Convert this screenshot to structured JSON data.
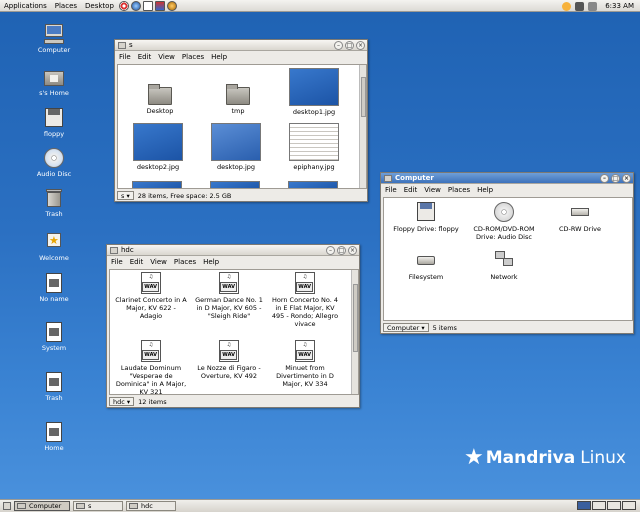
{
  "top_panel": {
    "menus": [
      "Applications",
      "Places",
      "Desktop"
    ],
    "launchers": [
      "lifebuoy-icon",
      "web-browser-icon",
      "mail-icon",
      "office-icon",
      "terminal-icon"
    ],
    "tray_icons": [
      "speaker-icon",
      "power-icon",
      "network-icon"
    ],
    "clock": "6:33 AM"
  },
  "desktop_icons": [
    {
      "label": "Computer",
      "icon": "computer-icon"
    },
    {
      "label": "s's Home",
      "icon": "home-folder-icon"
    },
    {
      "label": "floppy",
      "icon": "floppy-icon"
    },
    {
      "label": "Audio Disc",
      "icon": "cd-icon"
    },
    {
      "label": "Trash",
      "icon": "trash-icon"
    },
    {
      "label": "Welcome",
      "icon": "welcome-icon"
    },
    {
      "label": "No name",
      "icon": "document-icon"
    },
    {
      "label": "System",
      "icon": "system-folder-icon"
    },
    {
      "label": "Trash",
      "icon": "trash-folder-icon"
    },
    {
      "label": "Home",
      "icon": "home-icon"
    }
  ],
  "menu_labels": [
    "File",
    "Edit",
    "View",
    "Places",
    "Help"
  ],
  "win_s": {
    "title": "s",
    "items": [
      {
        "label": "Desktop",
        "kind": "folder"
      },
      {
        "label": "tmp",
        "kind": "folder"
      },
      {
        "label": "desktop1.jpg",
        "kind": "image"
      },
      {
        "label": "desktop2.jpg",
        "kind": "image"
      },
      {
        "label": "desktop.jpg",
        "kind": "image"
      },
      {
        "label": "epiphany.jpg",
        "kind": "image"
      }
    ],
    "location": "s",
    "status": "28 items, Free space: 2.5 GB"
  },
  "win_hdc": {
    "title": "hdc",
    "items": [
      {
        "label": "Clarinet Concerto in A Major, KV 622 - Adagio"
      },
      {
        "label": "German Dance No. 1 in D Major, KV 605 - \"Sleigh Ride\""
      },
      {
        "label": "Horn Concerto No. 4 in E Flat Major, KV 495 - Rondo; Allegro vivace"
      },
      {
        "label": "Laudate Dominum \"Vesperae de Dominica\" in A Major, KV 321"
      },
      {
        "label": "Le Nozze di Figaro - Overture, KV 492"
      },
      {
        "label": "Minuet from Divertimento in D Major, KV 334"
      }
    ],
    "location": "hdc",
    "status": "12 items"
  },
  "win_computer": {
    "title": "Computer",
    "items": [
      {
        "label": "Floppy Drive: floppy",
        "icon": "floppy-drive-icon"
      },
      {
        "label": "CD-ROM/DVD-ROM Drive: Audio Disc",
        "icon": "cd-drive-icon"
      },
      {
        "label": "CD-RW Drive",
        "icon": "cdrw-drive-icon"
      },
      {
        "label": "Filesystem",
        "icon": "filesystem-icon"
      },
      {
        "label": "Network",
        "icon": "network-icon"
      }
    ],
    "location": "Computer",
    "status": "5 items"
  },
  "taskbar": {
    "show_desktop": "show-desktop-icon",
    "tasks": [
      {
        "label": "Computer",
        "active": true
      },
      {
        "label": "s",
        "active": false
      },
      {
        "label": "hdc",
        "active": false
      }
    ],
    "workspace_switcher": "workspace-switcher"
  },
  "branding": {
    "brand": "Mandriva",
    "suffix": "Linux",
    "color": "#ffffff"
  }
}
